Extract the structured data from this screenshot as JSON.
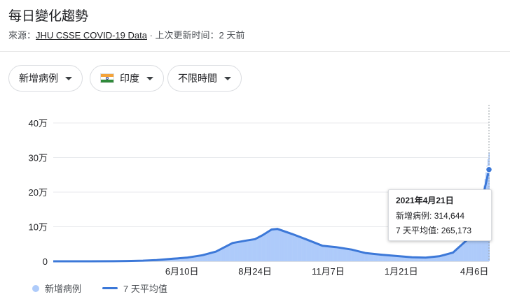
{
  "header": {
    "title": "每日變化趨勢",
    "source_prefix": "來源：",
    "source_link": "JHU CSSE COVID-19 Data",
    "source_suffix": " · 上次更新时间：2 天前"
  },
  "filters": {
    "metric": "新增病例",
    "country": "印度",
    "range": "不限時間"
  },
  "tooltip": {
    "date": "2021年4月21日",
    "new_cases_label": "新增病例",
    "new_cases_value": "314,644",
    "avg_label": "7 天平均值",
    "avg_value": "265,173"
  },
  "legend": {
    "bars": "新增病例",
    "line": "7 天平均值"
  },
  "colors": {
    "bars": "#aecbfa",
    "line": "#3c78d8",
    "grid": "#e8eaed"
  },
  "chart_data": {
    "type": "bar",
    "y_tick_labels": [
      "0",
      "10万",
      "20万",
      "30万",
      "40万"
    ],
    "ylim": [
      0,
      400000
    ],
    "x_tick_labels": [
      "6月10日",
      "8月24日",
      "11月7日",
      "1月21日",
      "4月6日"
    ],
    "x_tick_dates": [
      "2020-06-10",
      "2020-08-24",
      "2020-11-07",
      "2021-01-21",
      "2021-04-06"
    ],
    "x_start": "2020-01-30",
    "x_end": "2021-04-21",
    "grid": true,
    "legend_position": "bottom-left",
    "series": [
      {
        "name": "新增病例",
        "kind": "bar",
        "points": [
          [
            "2020-01-30",
            0
          ],
          [
            "2020-03-01",
            0
          ],
          [
            "2020-04-01",
            400
          ],
          [
            "2020-04-15",
            1000
          ],
          [
            "2020-05-01",
            2000
          ],
          [
            "2020-05-15",
            3900
          ],
          [
            "2020-06-01",
            8000
          ],
          [
            "2020-06-15",
            11000
          ],
          [
            "2020-07-01",
            19000
          ],
          [
            "2020-07-15",
            29000
          ],
          [
            "2020-08-01",
            55000
          ],
          [
            "2020-08-15",
            62000
          ],
          [
            "2020-08-24",
            66000
          ],
          [
            "2020-09-01",
            78000
          ],
          [
            "2020-09-10",
            95000
          ],
          [
            "2020-09-16",
            97000
          ],
          [
            "2020-10-01",
            82000
          ],
          [
            "2020-10-15",
            65000
          ],
          [
            "2020-11-01",
            47000
          ],
          [
            "2020-11-15",
            42000
          ],
          [
            "2020-12-01",
            35000
          ],
          [
            "2020-12-15",
            25000
          ],
          [
            "2021-01-01",
            20000
          ],
          [
            "2021-01-15",
            16000
          ],
          [
            "2021-02-01",
            12000
          ],
          [
            "2021-02-15",
            11000
          ],
          [
            "2021-03-01",
            15000
          ],
          [
            "2021-03-15",
            26000
          ],
          [
            "2021-04-01",
            72000
          ],
          [
            "2021-04-08",
            126000
          ],
          [
            "2021-04-15",
            200000
          ],
          [
            "2021-04-21",
            314644
          ]
        ]
      },
      {
        "name": "7 天平均值",
        "kind": "line",
        "points": [
          [
            "2020-01-30",
            0
          ],
          [
            "2020-03-01",
            0
          ],
          [
            "2020-04-01",
            300
          ],
          [
            "2020-04-15",
            900
          ],
          [
            "2020-05-01",
            1800
          ],
          [
            "2020-05-15",
            3600
          ],
          [
            "2020-06-01",
            7500
          ],
          [
            "2020-06-15",
            10500
          ],
          [
            "2020-07-01",
            17500
          ],
          [
            "2020-07-15",
            28000
          ],
          [
            "2020-08-01",
            53000
          ],
          [
            "2020-08-15",
            60000
          ],
          [
            "2020-08-24",
            64000
          ],
          [
            "2020-09-01",
            76000
          ],
          [
            "2020-09-10",
            92000
          ],
          [
            "2020-09-16",
            93600
          ],
          [
            "2020-10-01",
            79000
          ],
          [
            "2020-10-15",
            64000
          ],
          [
            "2020-11-01",
            45000
          ],
          [
            "2020-11-15",
            41000
          ],
          [
            "2020-12-01",
            34000
          ],
          [
            "2020-12-15",
            24000
          ],
          [
            "2021-01-01",
            19000
          ],
          [
            "2021-01-15",
            15500
          ],
          [
            "2021-02-01",
            11500
          ],
          [
            "2021-02-15",
            10800
          ],
          [
            "2021-03-01",
            14500
          ],
          [
            "2021-03-15",
            25000
          ],
          [
            "2021-04-01",
            68000
          ],
          [
            "2021-04-08",
            120000
          ],
          [
            "2021-04-15",
            190000
          ],
          [
            "2021-04-21",
            265173
          ]
        ]
      }
    ]
  }
}
